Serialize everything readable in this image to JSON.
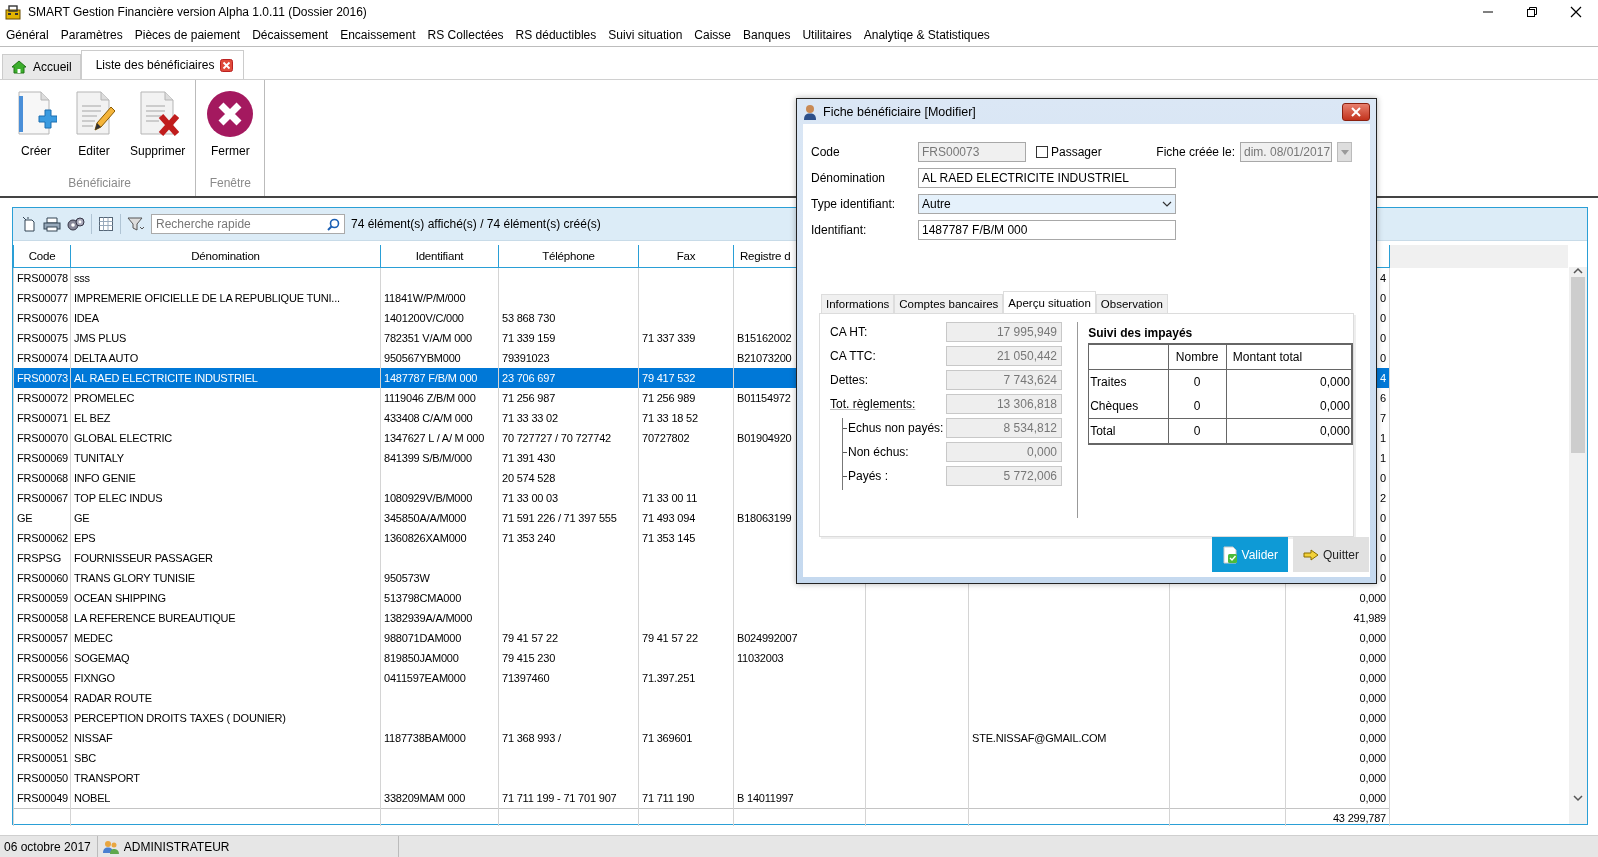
{
  "window": {
    "title": "SMART Gestion Financière version Alpha 1.0.11 (Dossier 2016)"
  },
  "menu": [
    "Général",
    "Paramètres",
    "Pièces de paiement",
    "Décaissement",
    "Encaissement",
    "RS Collectées",
    "RS déductibles",
    "Suivi situation",
    "Caisse",
    "Banques",
    "Utilitaires",
    "Analytiqe & Statistiques"
  ],
  "doc_tabs": [
    {
      "label": "Accueil",
      "kind": "home",
      "selected": false
    },
    {
      "label": "Liste des bénéficiaires",
      "kind": "closable",
      "selected": true
    }
  ],
  "ribbon": {
    "groups": [
      {
        "label": "Bénéficiaire",
        "buttons": [
          {
            "label": "Créer",
            "kind": "create"
          },
          {
            "label": "Editer",
            "kind": "edit"
          },
          {
            "label": "Supprimer",
            "kind": "delete"
          }
        ]
      },
      {
        "label": "Fenêtre",
        "buttons": [
          {
            "label": "Fermer",
            "kind": "close"
          }
        ]
      }
    ]
  },
  "grid_toolbar": {
    "search": {
      "placeholder": "Recherche rapide"
    },
    "count": "74 élément(s) affiché(s) / 74 élément(s) créé(s)"
  },
  "table": {
    "columns": [
      "Code",
      "Dénomination",
      "Identifiant",
      "Téléphone",
      "Fax",
      "Registre d"
    ],
    "rows": [
      {
        "code": "FRS00078",
        "denomination": "sss",
        "column_10": "4",
        "selected": false
      },
      {
        "code": "FRS00077",
        "denomination": "IMPREMERIE OFICIELLE DE LA REPUBLIQUE TUNI...",
        "identifiant": "11841W/P/M/000",
        "column_10": "0",
        "selected": false
      },
      {
        "code": "FRS00076",
        "denomination": "IDEA",
        "identifiant": "1401200V/C/000",
        "telephone": "53 868 730",
        "column_10": "0",
        "selected": false
      },
      {
        "code": "FRS00075",
        "denomination": "JMS PLUS",
        "identifiant": "782351 V/A/M 000",
        "telephone": "71 339 159",
        "fax": "71 337 339",
        "registre": "B15162002",
        "column_10": "0",
        "selected": false
      },
      {
        "code": "FRS00074",
        "denomination": "DELTA AUTO",
        "identifiant": "950567YBM000",
        "telephone": "79391023",
        "registre": "B21073200",
        "column_10": "0",
        "selected": false
      },
      {
        "code": "FRS00073",
        "denomination": "AL RAED ELECTRICITE INDUSTRIEL",
        "identifiant": "1487787 F/B/M 000",
        "telephone": "23 706 697",
        "fax": "79 417 532",
        "column_10": "4",
        "selected": true
      },
      {
        "code": "FRS00072",
        "denomination": "PROMELEC",
        "identifiant": "1119046 Z/B/M 000",
        "telephone": "71 256 987",
        "fax": "71 256 989",
        "registre": "B01154972",
        "column_10": "6",
        "selected": false
      },
      {
        "code": "FRS00071",
        "denomination": "EL BEZ",
        "identifiant": "433408 C/A/M 000",
        "telephone": "71 33 33 02",
        "fax": "71 33 18 52",
        "column_10": "7",
        "selected": false
      },
      {
        "code": "FRS00070",
        "denomination": "GLOBAL ELECTRIC",
        "identifiant": "1347627 L / A/ M 000",
        "telephone": "70 727727 / 70 727742",
        "fax": "70727802",
        "registre": "B01904920",
        "column_10": "1",
        "selected": false
      },
      {
        "code": "FRS00069",
        "denomination": "TUNITALY",
        "identifiant": "841399 S/B/M/000",
        "telephone": "71 391 430",
        "column_10": "1",
        "selected": false
      },
      {
        "code": "FRS00068",
        "denomination": "INFO GENIE",
        "telephone": "20 574 528",
        "column_10": "0",
        "selected": false
      },
      {
        "code": "FRS00067",
        "denomination": "TOP ELEC INDUS",
        "identifiant": "1080929V/B/M000",
        "telephone": "71 33 00 03",
        "fax": "71 33 00 11",
        "column_10": "2",
        "selected": false
      },
      {
        "code": "GE",
        "denomination": "GE",
        "identifiant": "345850A/A/M000",
        "telephone": "71 591 226 / 71 397 555",
        "fax": "71 493 094",
        "registre": "B18063199",
        "column_10": "0",
        "selected": false
      },
      {
        "code": "FRS00062",
        "denomination": "EPS",
        "identifiant": "1360826XAM000",
        "telephone": "71 353 240",
        "fax": "71 353 145",
        "column_10": "0",
        "selected": false
      },
      {
        "code": "FRSPSG",
        "denomination": "FOURNISSEUR PASSAGER",
        "column_10": "0",
        "selected": false
      },
      {
        "code": "FRS00060",
        "denomination": "TRANS GLORY TUNISIE",
        "identifiant": "950573W",
        "column_10": "0",
        "selected": false
      },
      {
        "code": "FRS00059",
        "denomination": "OCEAN SHIPPING",
        "identifiant": "513798CMA000",
        "column_10": "0,000",
        "selected": false
      },
      {
        "code": "FRS00058",
        "denomination": "LA REFERENCE BUREAUTIQUE",
        "identifiant": "1382939A/A/M000",
        "column_10": "41,989",
        "selected": false
      },
      {
        "code": "FRS00057",
        "denomination": "MEDEC",
        "identifiant": "988071DAM000",
        "telephone": "79 41 57 22",
        "fax": "79 41 57 22",
        "registre": "B024992007",
        "column_10": "0,000",
        "selected": false
      },
      {
        "code": "FRS00056",
        "denomination": "SOGEMAQ",
        "identifiant": "819850JAM000",
        "telephone": "79 415 230",
        "registre": "11032003",
        "column_10": "0,000",
        "selected": false
      },
      {
        "code": "FRS00055",
        "denomination": "FIXNGO",
        "identifiant": "0411597EAM000",
        "telephone": "71397460",
        "fax": "71.397.251",
        "column_10": "0,000",
        "selected": false
      },
      {
        "code": "FRS00054",
        "denomination": "RADAR ROUTE",
        "column_10": "0,000",
        "selected": false
      },
      {
        "code": "FRS00053",
        "denomination": "PERCEPTION DROITS TAXES ( DOUNIER)",
        "column_10": "0,000",
        "selected": false
      },
      {
        "code": "FRS00052",
        "denomination": "NISSAF",
        "identifiant": "1187738BAM000",
        "telephone": "71 368 993 /",
        "fax": "71 369601",
        "column_8": "STE.NISSAF@GMAIL.COM",
        "column_10": "0,000",
        "selected": false
      },
      {
        "code": "FRS00051",
        "denomination": "SBC",
        "column_10": "0,000",
        "selected": false
      },
      {
        "code": "FRS00050",
        "denomination": "TRANSPORT",
        "column_10": "0,000",
        "selected": false
      },
      {
        "code": "FRS00049",
        "denomination": "NOBEL",
        "identifiant": "338209MAM 000",
        "telephone": "71 711 199 - 71 701 907",
        "fax": "71 711 190",
        "registre": "B 14011997",
        "column_10": "0,000",
        "selected": false
      }
    ],
    "footer": {
      "column_10": "43 299,787"
    }
  },
  "dialog": {
    "title": "Fiche bénéficiaire [Modifier]",
    "code": {
      "label": "Code",
      "value": "FRS00073",
      "disabled": true
    },
    "passager": {
      "label": "Passager",
      "checked": false
    },
    "created": {
      "label": "Fiche créée le:",
      "value": "dim. 08/01/2017",
      "disabled": true
    },
    "denomination": {
      "label": "Dénomination",
      "value": "AL RAED ELECTRICITE INDUSTRIEL"
    },
    "type_identifiant": {
      "label": "Type identifiant:",
      "value": "Autre"
    },
    "identifiant": {
      "label": "Identifiant:",
      "value": "1487787 F/B/M 000"
    },
    "tabs": [
      {
        "label": "Informations",
        "selected": false
      },
      {
        "label": "Comptes bancaires",
        "selected": false
      },
      {
        "label": "Aperçu situation",
        "selected": true
      },
      {
        "label": "Observation",
        "selected": false
      }
    ],
    "situation": [
      {
        "label": "CA HT:",
        "value": "17 995,949"
      },
      {
        "label": "CA TTC:",
        "value": "21 050,442"
      },
      {
        "label": "Dettes:",
        "value": "7 743,624"
      },
      {
        "label": "Tot. règlements:",
        "value": "13 306,818",
        "children": [
          {
            "label": "Echus non payés:",
            "value": "8 534,812"
          },
          {
            "label": "Non échus:",
            "value": "0,000"
          },
          {
            "label": "Payés :",
            "value": "5 772,006"
          }
        ]
      }
    ],
    "impayes": {
      "title": "Suivi des impayés",
      "columns": [
        "Nombre",
        "Montant total"
      ],
      "rows": [
        {
          "label": "Traites",
          "nombre": "0",
          "montant": "0,000"
        },
        {
          "label": "Chèques",
          "nombre": "0",
          "montant": "0,000"
        }
      ],
      "total": {
        "label": "Total",
        "nombre": "0",
        "montant": "0,000"
      }
    },
    "buttons": [
      {
        "label": "Valider",
        "kind": "primary"
      },
      {
        "label": "Quitter",
        "kind": "secondary"
      }
    ]
  },
  "status_bar": {
    "date": "06 octobre 2017",
    "user": "ADMINISTRATEUR"
  }
}
